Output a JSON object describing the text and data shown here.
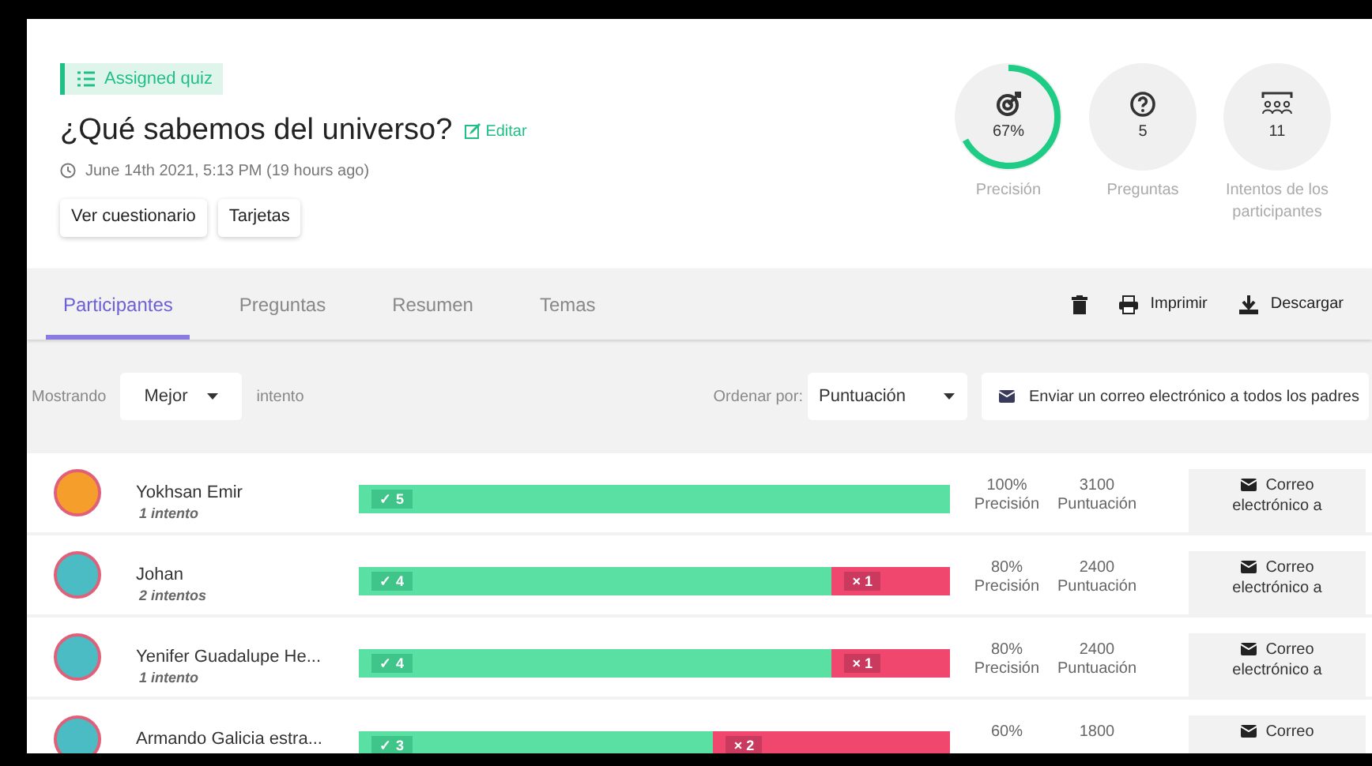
{
  "badge": {
    "label": "Assigned quiz"
  },
  "title": "¿Qué sabemos del universo?",
  "edit_link": "Editar",
  "timestamp": "June 14th 2021, 5:13 PM (19 hours ago)",
  "header_buttons": [
    "Ver cuestionario",
    "Tarjetas"
  ],
  "stats": [
    {
      "kind": "accuracy",
      "value": "67%",
      "label": "Precisión",
      "level": 0.67
    },
    {
      "kind": "questions",
      "value": "5",
      "label": "Preguntas"
    },
    {
      "kind": "attempts",
      "value": "11",
      "label": "Intentos de los participantes"
    }
  ],
  "tabs": [
    {
      "label": "Participantes",
      "selected": true
    },
    {
      "label": "Preguntas",
      "selected": false
    },
    {
      "label": "Resumen",
      "selected": false
    },
    {
      "label": "Temas",
      "selected": false
    }
  ],
  "actions": [
    {
      "kind": "delete"
    },
    {
      "kind": "print",
      "label": "Imprimir"
    },
    {
      "kind": "download",
      "label": "Descargar"
    }
  ],
  "filters": {
    "showing_label": "Mostrando",
    "showing_value": "Mejor",
    "showing_suffix": "intento",
    "sort_label": "Ordenar por:",
    "sort_value": "Puntuación",
    "email_all": "Enviar un correo electrónico a todos los padres"
  },
  "participants": [
    {
      "name": "Yokhsan Emir",
      "attempts": "1 intento",
      "correct": "✓ 5",
      "level": 1,
      "accuracy": "100%",
      "accuracy_label": "Precisión",
      "score": "3100",
      "score_label": "Puntuación",
      "email_button": "Correo electrónico a"
    },
    {
      "name": "Johan",
      "attempts": "2 intentos",
      "correct": "✓ 4",
      "incorrect": "× 1",
      "level": 0.8,
      "accuracy": "80%",
      "accuracy_label": "Precisión",
      "score": "2400",
      "score_label": "Puntuación",
      "email_button": "Correo electrónico a"
    },
    {
      "name": "Yenifer Guadalupe He...",
      "attempts": "1 intento",
      "correct": "✓ 4",
      "incorrect": "× 1",
      "level": 0.8,
      "accuracy": "80%",
      "accuracy_label": "Precisión",
      "score": "2400",
      "score_label": "Puntuación",
      "email_button": "Correo electrónico a"
    },
    {
      "name": "Armando Galicia estra...",
      "correct": "✓ 3",
      "incorrect": "× 2",
      "level": 0.6,
      "accuracy": "60%",
      "score": "1800",
      "email_button": "Correo"
    }
  ]
}
